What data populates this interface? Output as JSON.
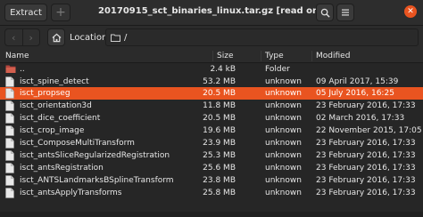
{
  "header": {
    "extract_label": "Extract",
    "new_icon": "plus-icon",
    "title": "20170915_sct_binaries_linux.tar.gz [read only]",
    "search_icon": "search-icon",
    "menu_icon": "hamburger-menu-icon",
    "close_icon": "close-icon",
    "accent_color": "#e95420"
  },
  "location": {
    "back_icon": "chevron-left-icon",
    "forward_icon": "chevron-right-icon",
    "home_icon": "home-icon",
    "label": "Location:",
    "path": "/"
  },
  "table": {
    "columns": [
      "Name",
      "Size",
      "Type",
      "Modified"
    ],
    "rows": [
      {
        "name": "..",
        "size": "2.4 kB",
        "type": "Folder",
        "modified": "",
        "icon": "folder-icon",
        "selected": false
      },
      {
        "name": "isct_spine_detect",
        "size": "53.2 MB",
        "type": "unknown",
        "modified": "09 April 2017, 15:39",
        "icon": "file-icon",
        "selected": false
      },
      {
        "name": "isct_propseg",
        "size": "20.5 MB",
        "type": "unknown",
        "modified": "05 July 2016, 16:25",
        "icon": "file-icon",
        "selected": true
      },
      {
        "name": "isct_orientation3d",
        "size": "11.8 MB",
        "type": "unknown",
        "modified": "23 February 2016, 17:33",
        "icon": "file-icon",
        "selected": false
      },
      {
        "name": "isct_dice_coefficient",
        "size": "20.5 MB",
        "type": "unknown",
        "modified": "02 March 2016, 17:33",
        "icon": "file-icon",
        "selected": false
      },
      {
        "name": "isct_crop_image",
        "size": "19.6 MB",
        "type": "unknown",
        "modified": "22 November 2015, 17:05",
        "icon": "file-icon",
        "selected": false
      },
      {
        "name": "isct_ComposeMultiTransform",
        "size": "23.9 MB",
        "type": "unknown",
        "modified": "23 February 2016, 17:33",
        "icon": "file-icon",
        "selected": false
      },
      {
        "name": "isct_antsSliceRegularizedRegistration",
        "size": "25.3 MB",
        "type": "unknown",
        "modified": "23 February 2016, 17:33",
        "icon": "file-icon",
        "selected": false
      },
      {
        "name": "isct_antsRegistration",
        "size": "25.6 MB",
        "type": "unknown",
        "modified": "23 February 2016, 17:33",
        "icon": "file-icon",
        "selected": false
      },
      {
        "name": "isct_ANTSLandmarksBSplineTransform",
        "size": "23.8 MB",
        "type": "unknown",
        "modified": "23 February 2016, 17:33",
        "icon": "file-icon",
        "selected": false
      },
      {
        "name": "isct_antsApplyTransforms",
        "size": "25.8 MB",
        "type": "unknown",
        "modified": "23 February 2016, 17:33",
        "icon": "file-icon",
        "selected": false
      }
    ]
  }
}
